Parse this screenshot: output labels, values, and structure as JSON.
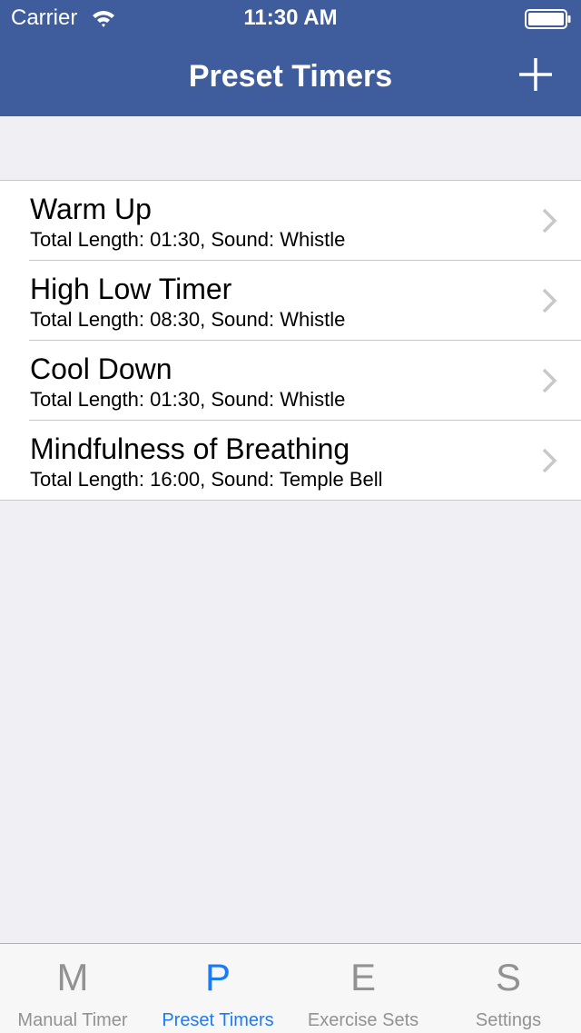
{
  "status_bar": {
    "carrier": "Carrier",
    "time": "11:30 AM",
    "wifi_icon": "wifi-icon",
    "battery_icon": "battery-icon"
  },
  "nav_bar": {
    "title": "Preset Timers",
    "add_icon": "plus-icon"
  },
  "timers": [
    {
      "name": "Warm Up",
      "details": "Total Length: 01:30, Sound: Whistle"
    },
    {
      "name": "High Low Timer",
      "details": "Total Length: 08:30, Sound: Whistle"
    },
    {
      "name": "Cool Down",
      "details": "Total Length: 01:30, Sound: Whistle"
    },
    {
      "name": "Mindfulness of Breathing",
      "details": "Total Length: 16:00, Sound: Temple Bell"
    }
  ],
  "tab_bar": {
    "tabs": [
      {
        "glyph": "M",
        "label": "Manual Timer",
        "active": false
      },
      {
        "glyph": "P",
        "label": "Preset Timers",
        "active": true
      },
      {
        "glyph": "E",
        "label": "Exercise Sets",
        "active": false
      },
      {
        "glyph": "S",
        "label": "Settings",
        "active": false
      }
    ]
  },
  "colors": {
    "nav_background": "#3f5c9c",
    "tab_active": "#1a7cf5",
    "tab_inactive": "#929292",
    "page_background": "#efeff4"
  }
}
